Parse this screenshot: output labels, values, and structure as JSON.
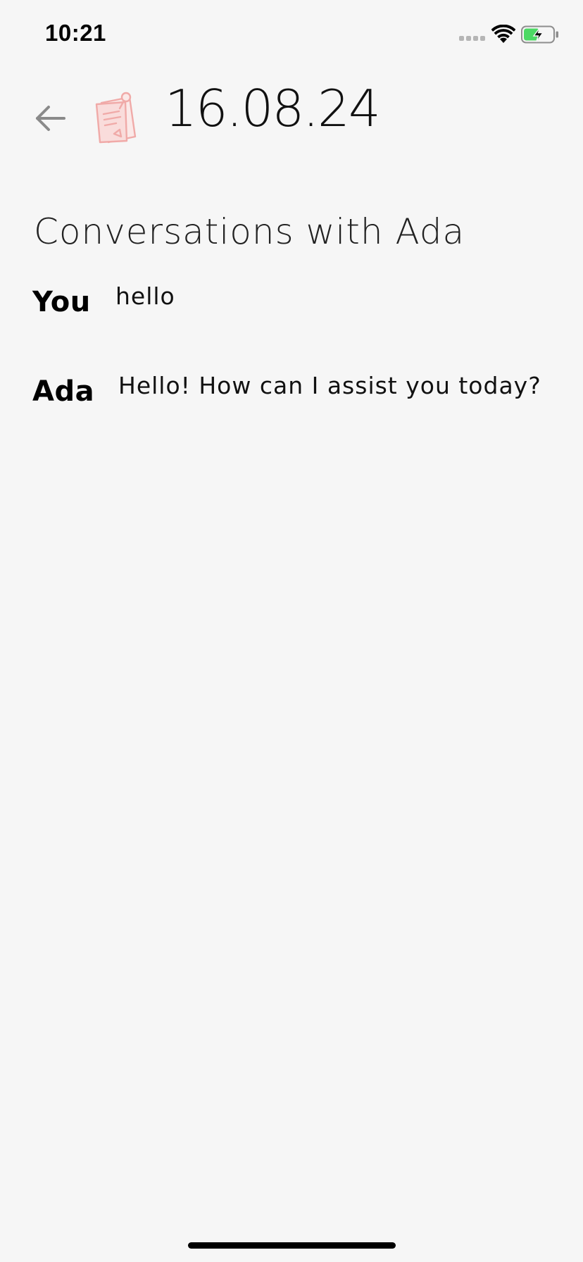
{
  "status_bar": {
    "time": "10:21",
    "icons": [
      "signal-dots-icon",
      "wifi-icon",
      "battery-charging-icon"
    ],
    "battery_color": "#4cd964"
  },
  "header": {
    "back_icon": "arrow-left-icon",
    "note_icon": "pinned-note-icon",
    "note_icon_color": "#f0aaa8",
    "title": "16.08.24"
  },
  "conversation": {
    "heading": "Conversations with Ada",
    "messages": [
      {
        "speaker": "You",
        "text": "hello"
      },
      {
        "speaker": "Ada",
        "text": "Hello! How can I assist you today?"
      }
    ]
  }
}
